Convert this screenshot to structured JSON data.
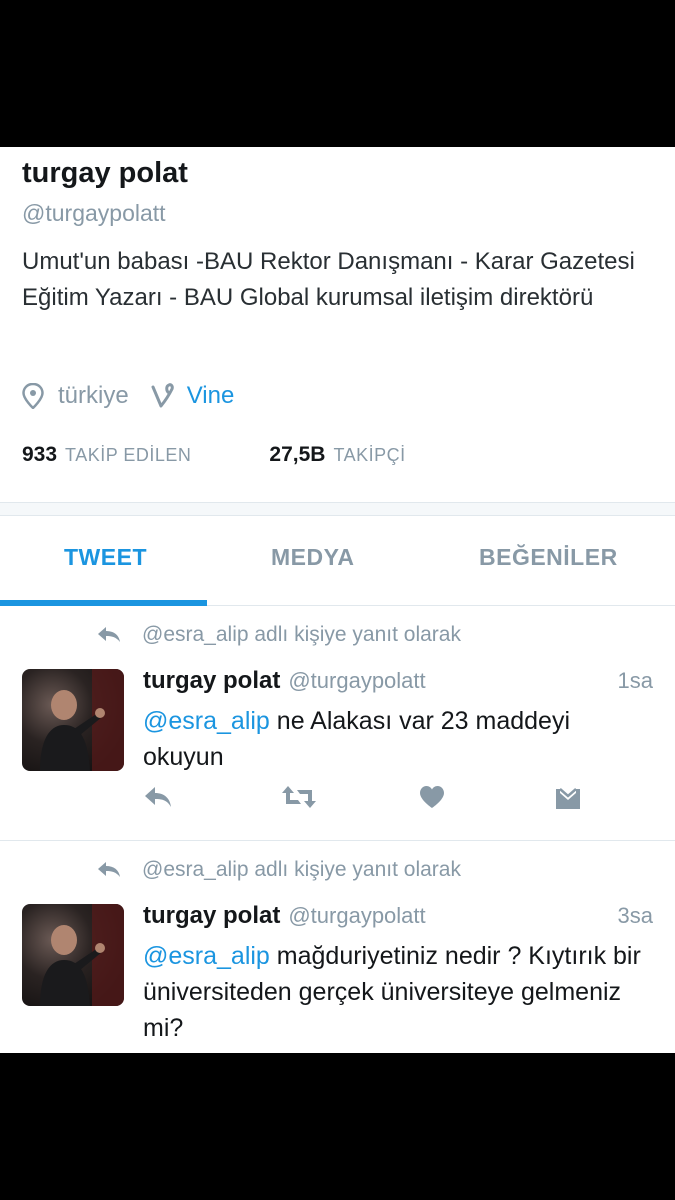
{
  "profile": {
    "name": "turgay polat",
    "handle": "@turgaypolatt",
    "bio": "Umut'un babası -BAU Rektor Danışmanı - Karar Gazetesi Eğitim Yazarı - BAU Global kurumsal iletişim direktörü",
    "location": "türkiye",
    "location_icon": "location-pin-icon",
    "link": "Vine",
    "link_icon": "vine-icon",
    "following_count": "933",
    "following_label": "TAKİP EDİLEN",
    "followers_count": "27,5B",
    "followers_label": "TAKİPÇİ"
  },
  "tabs": [
    {
      "label": "TWEET",
      "active": true
    },
    {
      "label": "MEDYA",
      "active": false
    },
    {
      "label": "BEĞENİLER",
      "active": false
    }
  ],
  "colors": {
    "accent": "#1b95e0",
    "muted": "#8899a6",
    "text": "#14171a"
  },
  "tweets": [
    {
      "reply_context": "@esra_alip adlı kişiye yanıt olarak",
      "name": "turgay polat",
      "handle": "@turgaypolatt",
      "time": "1sa",
      "mention": "@esra_alip",
      "text": " ne Alakası var 23 maddeyi okuyun"
    },
    {
      "reply_context": "@esra_alip adlı kişiye yanıt olarak",
      "name": "turgay polat",
      "handle": "@turgaypolatt",
      "time": "3sa",
      "mention": "@esra_alip",
      "text": " mağduriyetiniz nedir ? Kıytırık bir üniversiteden gerçek üniversiteye gelmeniz mi?"
    }
  ],
  "action_icons": [
    "reply-icon",
    "retweet-icon",
    "like-icon",
    "direct-message-icon"
  ]
}
